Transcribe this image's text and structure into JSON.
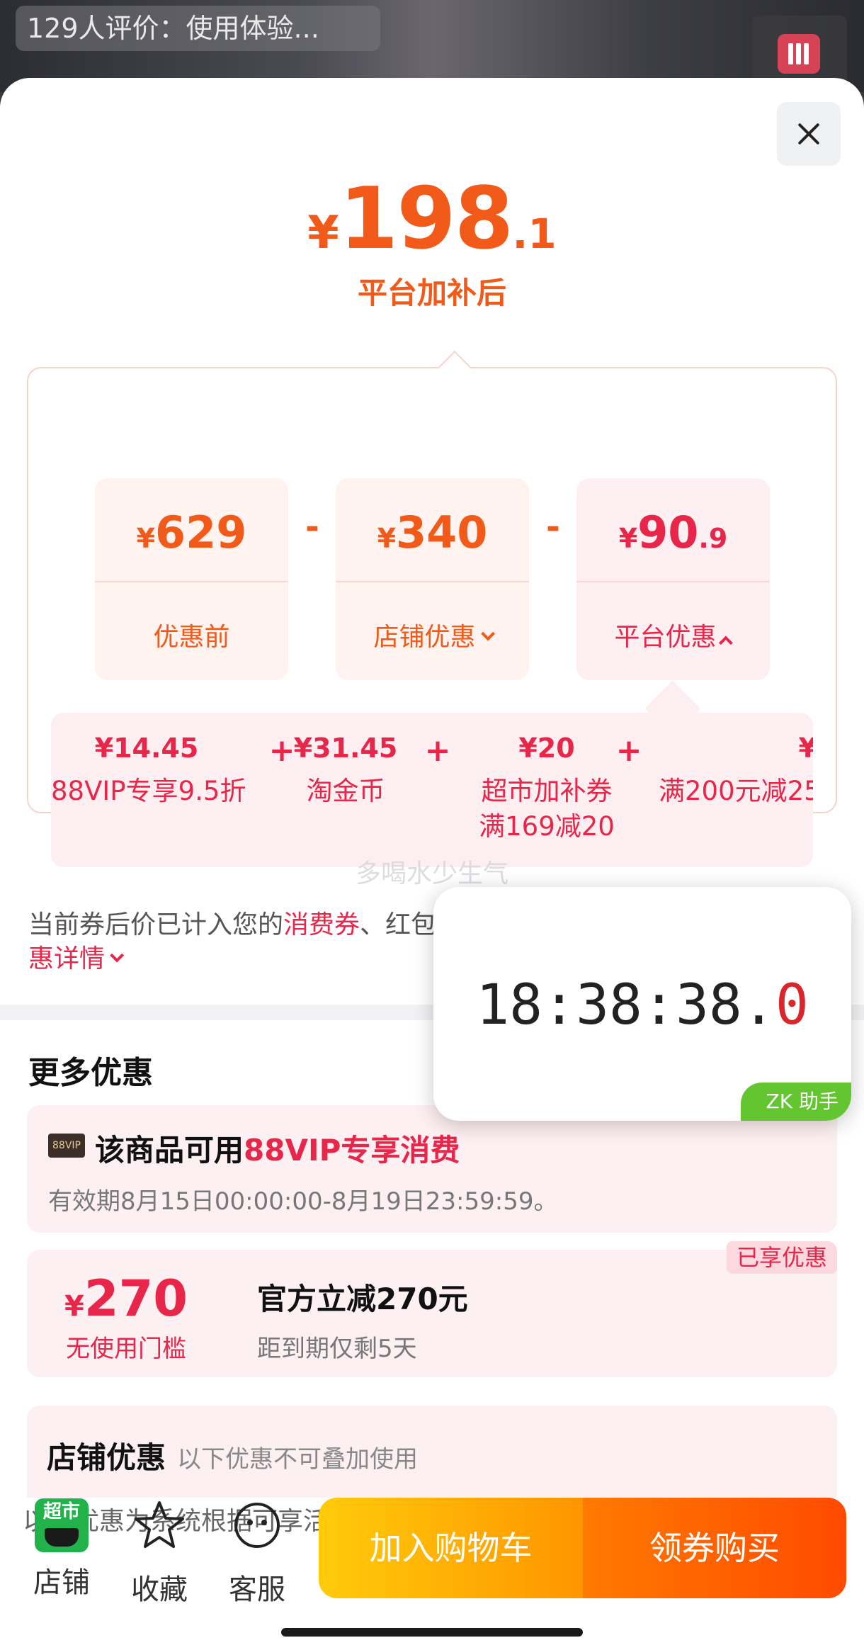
{
  "top": {
    "review_text": "129人评价：使用体验..."
  },
  "summary": {
    "final_yen": "¥",
    "final_int": "198",
    "final_dec": ".1",
    "final_label": "平台加补后"
  },
  "breakdown": [
    {
      "yen": "¥",
      "int": "629",
      "dec": "",
      "label": "优惠前"
    },
    {
      "yen": "¥",
      "int": "340",
      "dec": "",
      "label": "店铺优惠"
    },
    {
      "yen": "¥",
      "int": "90",
      "dec": ".9",
      "label": "平台优惠"
    }
  ],
  "operators": [
    "-",
    "-"
  ],
  "platform_details": [
    {
      "value": "¥14.45",
      "text": "88VIP专享9.5折",
      "text2": ""
    },
    {
      "value": "¥31.45",
      "text": "淘金币",
      "text2": ""
    },
    {
      "value": "¥20",
      "text": "超市加补券",
      "text2": "满169减20"
    },
    {
      "value": "¥",
      "text": "满200元减25",
      "text2": ""
    }
  ],
  "plus": [
    "+",
    "+",
    "+"
  ],
  "watermark": "多喝水少生气",
  "note": {
    "part1": "当前券后价已计入您的",
    "highlight1": "消费券",
    "part2": "、红包、购物券、淘金币等权益展开",
    "highlight2": "已享优惠详情"
  },
  "more": {
    "title": "更多优惠",
    "vip": {
      "badge": "88VIP",
      "title_prefix": "该商品可用",
      "title_highlight": "88VIP专享消费",
      "validity": "有效期8月15日00:00:00-8月19日23:59:59。"
    },
    "coupon": {
      "yen": "¥",
      "amount": "270",
      "condition": "无使用门槛",
      "name": "官方立减270元",
      "expiry": "距到期仅剩5天",
      "tag": "已享优惠"
    },
    "shop": {
      "title": "店铺优惠",
      "subtitle": "以下优惠不可叠加使用"
    }
  },
  "footer_note": "以上优惠为系统根据可享活动/优惠的预估值，查看详情 >",
  "bottom_bar": {
    "shop_icon_text": "超市",
    "shop_label": "店铺",
    "fav_label": "收藏",
    "service_label": "客服",
    "cart_button": "加入购物车",
    "buy_button": "领券购买"
  },
  "clock": {
    "time_main": "18:38:38.",
    "time_last": "0",
    "brand": "ZK 助手"
  },
  "colors": {
    "accent_orange": "#f25a1a",
    "accent_red": "#e8264a",
    "cart_gradient": [
      "#ffcb0a",
      "#ff9500"
    ],
    "buy_gradient": [
      "#ff7a00",
      "#ff4a00"
    ]
  }
}
